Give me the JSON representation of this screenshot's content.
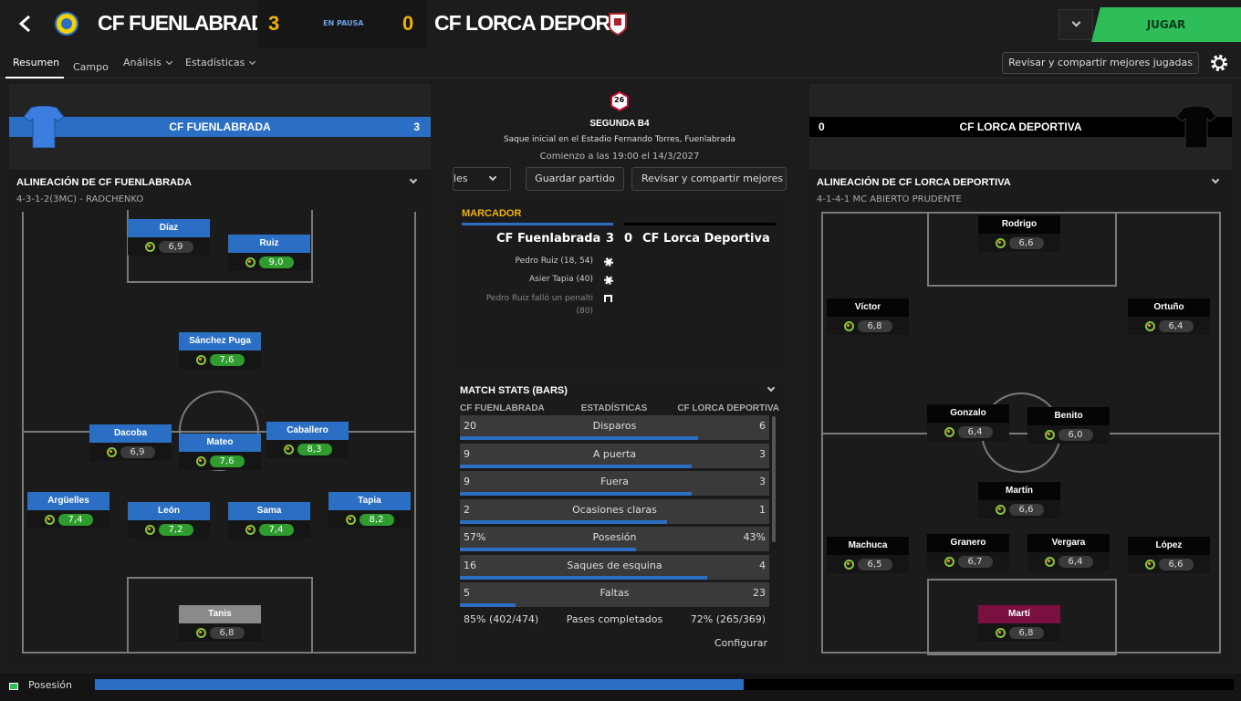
{
  "header": {
    "home_team": "CF FUENLABRADA",
    "home_score": "3",
    "status": "EN PAUSA",
    "away_score": "0",
    "away_team": "CF LORCA DEPOR...",
    "play_label": "JUGAR"
  },
  "nav": {
    "tabs": [
      "Resumen",
      "Campo",
      "Análisis",
      "Estadísticas"
    ],
    "share_label": "Revisar y compartir mejores jugadas"
  },
  "home": {
    "name": "CF FUENLABRADA",
    "score": "3",
    "lineup_title": "ALINEACIÓN DE CF FUENLABRADA",
    "formation": "4-3-1-2(3MC) - RADCHENKO"
  },
  "away": {
    "name": "CF LORCA DEPORTIVA",
    "score": "0",
    "lineup_title": "ALINEACIÓN DE CF LORCA DEPORTIVA",
    "formation": "4-1-4-1 MC ABIERTO PRUDENTE"
  },
  "home_players": [
    {
      "name": "Díaz",
      "rating": "6,9",
      "style": "blue",
      "green": false
    },
    {
      "name": "Ruiz",
      "rating": "9,0",
      "style": "blue",
      "green": true
    },
    {
      "name": "Sánchez Puga",
      "rating": "7,6",
      "style": "blue",
      "green": true
    },
    {
      "name": "Dacoba",
      "rating": "6,9",
      "style": "blue",
      "green": false
    },
    {
      "name": "Mateo",
      "rating": "7,6",
      "style": "blue",
      "green": true
    },
    {
      "name": "Caballero",
      "rating": "8,3",
      "style": "blue",
      "green": true
    },
    {
      "name": "Argüelles",
      "rating": "7,4",
      "style": "blue",
      "green": true
    },
    {
      "name": "León",
      "rating": "7,2",
      "style": "blue",
      "green": true
    },
    {
      "name": "Sama",
      "rating": "7,4",
      "style": "blue",
      "green": true
    },
    {
      "name": "Tapia",
      "rating": "8,2",
      "style": "blue",
      "green": true
    },
    {
      "name": "Tanis",
      "rating": "6,8",
      "style": "grey",
      "green": false
    }
  ],
  "away_players": [
    {
      "name": "Rodrigo",
      "rating": "6,6"
    },
    {
      "name": "Víctor",
      "rating": "6,8"
    },
    {
      "name": "Ortuño",
      "rating": "6,4"
    },
    {
      "name": "Gonzalo",
      "rating": "6,4"
    },
    {
      "name": "Benito",
      "rating": "6,0"
    },
    {
      "name": "Martín",
      "rating": "6,6"
    },
    {
      "name": "Machuca",
      "rating": "6,5"
    },
    {
      "name": "Granero",
      "rating": "6,7"
    },
    {
      "name": "Vergara",
      "rating": "6,4"
    },
    {
      "name": "López",
      "rating": "6,6"
    },
    {
      "name": "Martí",
      "rating": "6,8"
    }
  ],
  "match": {
    "competition_badge": "26",
    "competition": "SEGUNDA B4",
    "venue": "Saque inicial en el Estadio Fernando Torres, Fuenlabrada",
    "kickoff": "Comienzo a las 19:00 el 14/3/2027",
    "save_label": "Guardar partido",
    "share_label": "Revisar y compartir mejores ju",
    "dropdown_label": "les"
  },
  "scoreboard": {
    "title": "MARCADOR",
    "home": "CF Fuenlabrada",
    "home_score": "3",
    "away_score": "0",
    "away": "CF Lorca Deportiva",
    "events": [
      "Pedro Ruiz (18, 54)",
      "Asier Tapia (40)",
      "Pedro Ruiz falló un penalti",
      "(80)"
    ]
  },
  "stats": {
    "title": "MATCH STATS (BARS)",
    "home_header": "CF FUENLABRADA",
    "center_header": "ESTADÍSTICAS",
    "away_header": "CF LORCA DEPORTIVA",
    "configure_label": "Configurar",
    "rows": [
      {
        "home": "20",
        "label": "Disparos",
        "away": "6",
        "home_share": 0.77
      },
      {
        "home": "9",
        "label": "A puerta",
        "away": "3",
        "home_share": 0.75
      },
      {
        "home": "9",
        "label": "Fuera",
        "away": "3",
        "home_share": 0.75
      },
      {
        "home": "2",
        "label": "Ocasiones claras",
        "away": "1",
        "home_share": 0.67
      },
      {
        "home": "57%",
        "label": "Posesión",
        "away": "43%",
        "home_share": 0.57
      },
      {
        "home": "16",
        "label": "Saques de esquina",
        "away": "4",
        "home_share": 0.8
      },
      {
        "home": "5",
        "label": "Faltas",
        "away": "23",
        "home_share": 0.18
      }
    ],
    "last": {
      "home": "85% (402/474)",
      "label": "Pases completados",
      "away": "72% (265/369)"
    }
  },
  "footer": {
    "label": "Posesión",
    "home_share": 0.57
  },
  "colors": {
    "home": "#2b6fc4",
    "away": "#000000",
    "accent": "#2ebd59",
    "gold": "#f0b400",
    "gk_away": "#7a1040"
  }
}
